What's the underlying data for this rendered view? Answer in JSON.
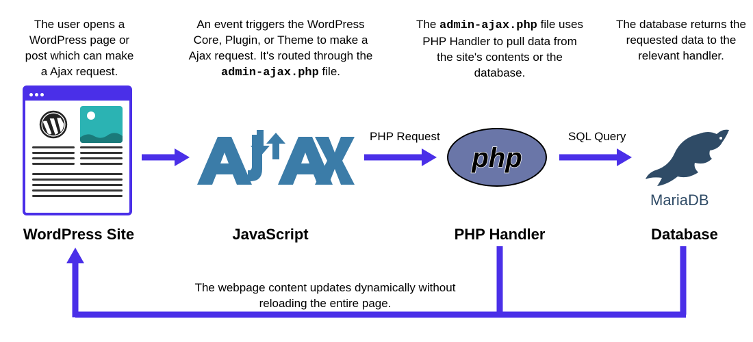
{
  "descriptions": {
    "wordpress": "The user opens a WordPress page or post which can make a Ajax request.",
    "javascript_pre": "An event triggers the WordPress Core, Plugin, or Theme to make a Ajax request. It's routed through the ",
    "javascript_file": "admin-ajax.php",
    "javascript_post": " file.",
    "php_pre": "The ",
    "php_file": "admin-ajax.php",
    "php_post": " file uses PHP Handler to pull data from the site's contents or the database.",
    "database": "The database returns the requested data to the relevant handler."
  },
  "nodes": {
    "wordpress": "WordPress Site",
    "javascript": "JavaScript",
    "php": "PHP Handler",
    "database": "Database"
  },
  "arrows": {
    "php_request": "PHP Request",
    "sql_query": "SQL Query"
  },
  "return_caption": "The webpage content updates dynamically without reloading the entire page.",
  "logos": {
    "ajax": "AJAX",
    "php": "php",
    "mariadb": "MariaDB"
  },
  "colors": {
    "arrow": "#4a2fe8",
    "ajax_blue": "#3b7ca8",
    "php_bg": "#6a76a8",
    "mariadb_text": "#2f4b66",
    "mariadb_seal": "#2f4b66"
  }
}
